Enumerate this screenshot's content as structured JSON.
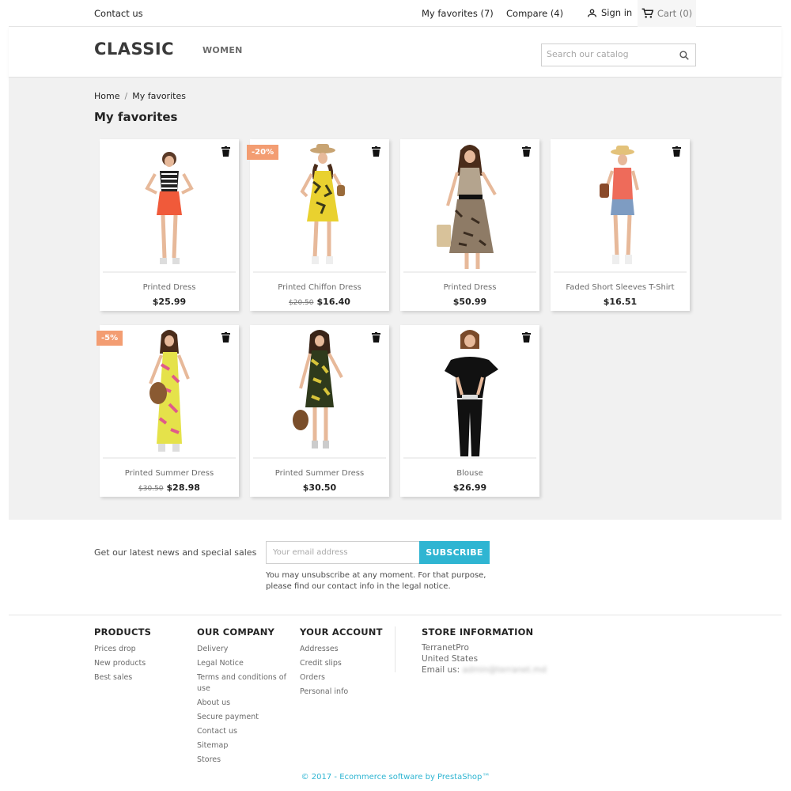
{
  "topbar": {
    "contact": "Contact us",
    "favorites": "My favorites (7)",
    "compare": "Compare (4)",
    "signin": "Sign in",
    "cart": "Cart (0)"
  },
  "header": {
    "logo": "CLASSIC",
    "nav_women": "WOMEN",
    "search_placeholder": "Search our catalog"
  },
  "breadcrumb": {
    "home": "Home",
    "separator": "/",
    "current": "My favorites"
  },
  "page_title": "My favorites",
  "products": [
    {
      "name": "Printed Dress",
      "price": "$25.99",
      "old_price": "",
      "badge": ""
    },
    {
      "name": "Printed Chiffon Dress",
      "price": "$16.40",
      "old_price": "$20.50",
      "badge": "-20%"
    },
    {
      "name": "Printed Dress",
      "price": "$50.99",
      "old_price": "",
      "badge": ""
    },
    {
      "name": "Faded Short Sleeves T-Shirt",
      "price": "$16.51",
      "old_price": "",
      "badge": ""
    },
    {
      "name": "Printed Summer Dress",
      "price": "$28.98",
      "old_price": "$30.50",
      "badge": "-5%"
    },
    {
      "name": "Printed Summer Dress",
      "price": "$30.50",
      "old_price": "",
      "badge": ""
    },
    {
      "name": "Blouse",
      "price": "$26.99",
      "old_price": "",
      "badge": ""
    }
  ],
  "newsletter": {
    "label": "Get our latest news and special sales",
    "placeholder": "Your email address",
    "button": "SUBSCRIBE",
    "note": "You may unsubscribe at any moment. For that purpose, please find our contact info in the legal notice."
  },
  "footer": {
    "products": {
      "title": "PRODUCTS",
      "links": [
        "Prices drop",
        "New products",
        "Best sales"
      ]
    },
    "company": {
      "title": "OUR COMPANY",
      "links": [
        "Delivery",
        "Legal Notice",
        "Terms and conditions of use",
        "About us",
        "Secure payment",
        "Contact us",
        "Sitemap",
        "Stores"
      ]
    },
    "account": {
      "title": "YOUR ACCOUNT",
      "links": [
        "Addresses",
        "Credit slips",
        "Orders",
        "Personal info"
      ]
    },
    "store": {
      "title": "STORE INFORMATION",
      "name": "TerranetPro",
      "country": "United States",
      "email_label": "Email us:",
      "email": "admin@terranet.md"
    }
  },
  "copyright": "© 2017 - Ecommerce software by PrestaShop™",
  "colors": {
    "accent": "#2fb5d2",
    "badge": "#f39d72",
    "main_bg": "#f1f1f1"
  }
}
